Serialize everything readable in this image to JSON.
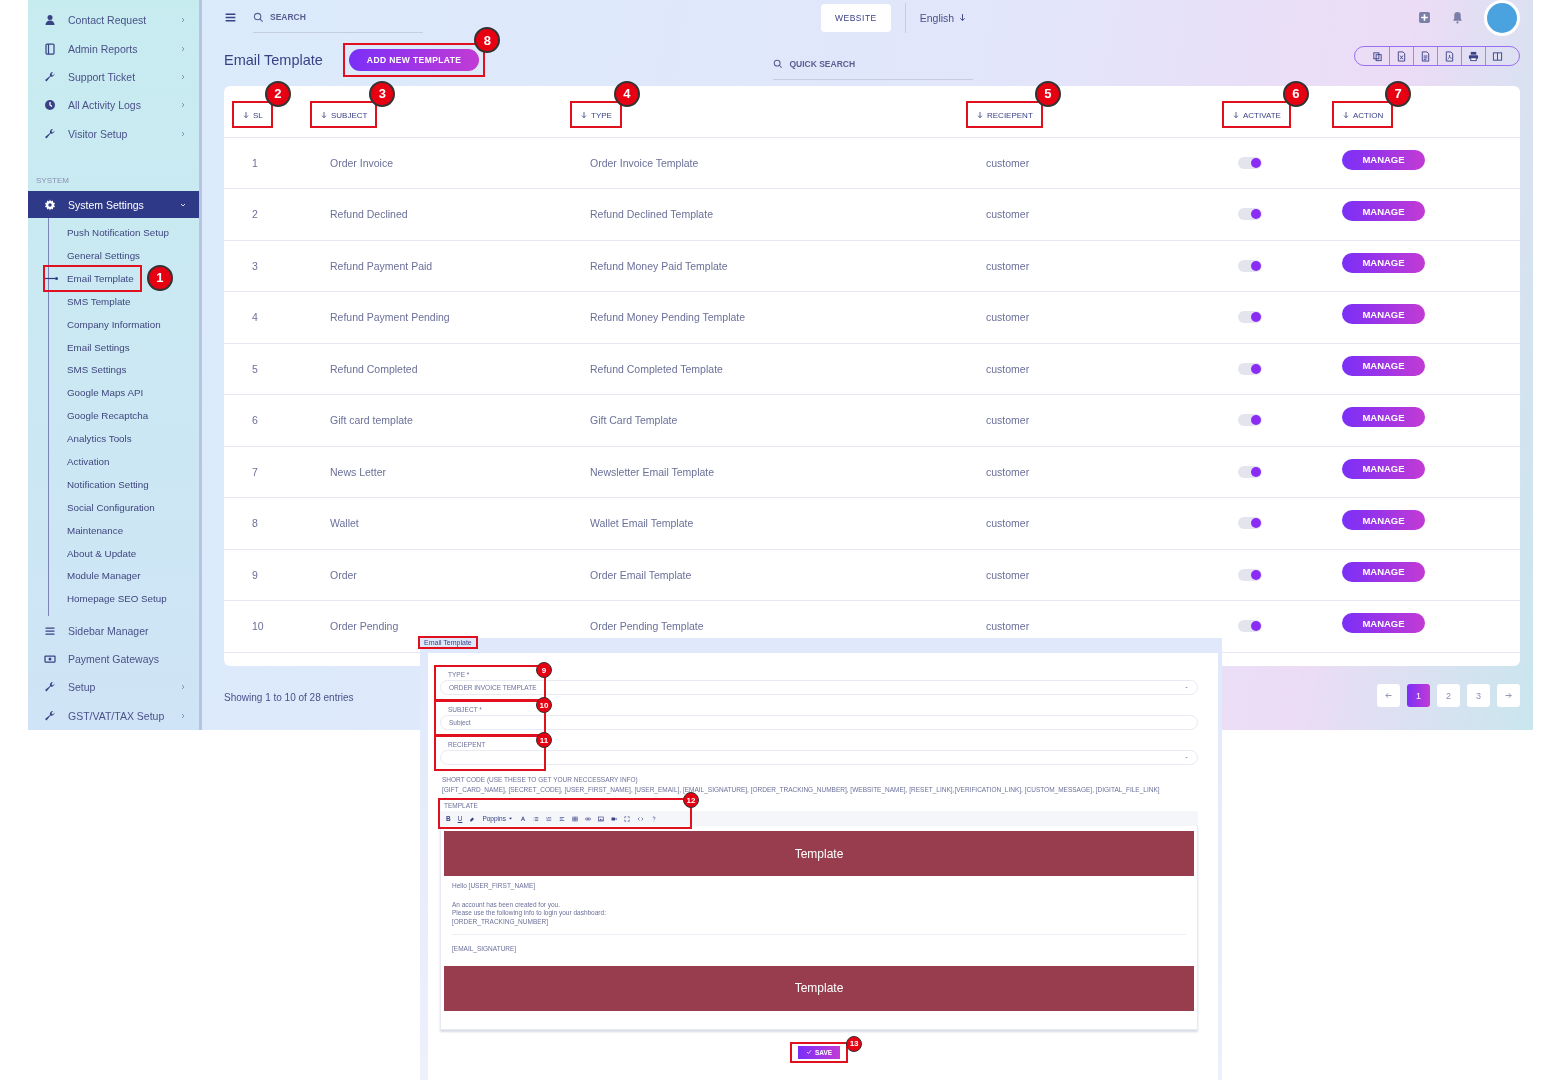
{
  "sidebar": {
    "top_items": [
      {
        "label": "Contact Request",
        "has_submenu": true
      },
      {
        "label": "Admin Reports",
        "has_submenu": true
      },
      {
        "label": "Support Ticket",
        "has_submenu": true
      },
      {
        "label": "All Activity Logs",
        "has_submenu": true
      },
      {
        "label": "Visitor Setup",
        "has_submenu": true
      }
    ],
    "section": "SYSTEM",
    "settings": {
      "label": "System Settings",
      "expanded": true,
      "children": [
        {
          "label": "Push Notification Setup",
          "selected": false
        },
        {
          "label": "General Settings",
          "selected": false
        },
        {
          "label": "Email Template",
          "selected": true,
          "callout": "1"
        },
        {
          "label": "SMS Template",
          "selected": false
        },
        {
          "label": "Company Information",
          "selected": false
        },
        {
          "label": "Email Settings",
          "selected": false
        },
        {
          "label": "SMS Settings",
          "selected": false
        },
        {
          "label": "Google Maps API",
          "selected": false
        },
        {
          "label": "Google Recaptcha",
          "selected": false
        },
        {
          "label": "Analytics Tools",
          "selected": false
        },
        {
          "label": "Activation",
          "selected": false
        },
        {
          "label": "Notification Setting",
          "selected": false
        },
        {
          "label": "Social Configuration",
          "selected": false
        },
        {
          "label": "Maintenance",
          "selected": false
        },
        {
          "label": "About & Update",
          "selected": false
        },
        {
          "label": "Module Manager",
          "selected": false
        },
        {
          "label": "Homepage SEO Setup",
          "selected": false
        }
      ]
    },
    "bottom_items": [
      {
        "label": "Sidebar Manager",
        "has_submenu": false
      },
      {
        "label": "Payment Gateways",
        "has_submenu": false
      },
      {
        "label": "Setup",
        "has_submenu": true
      },
      {
        "label": "GST/VAT/TAX Setup",
        "has_submenu": true
      }
    ]
  },
  "topbar": {
    "search_placeholder": "SEARCH",
    "website": "WEBSITE",
    "language": "English"
  },
  "page": {
    "title": "Email Template",
    "add_button": {
      "label": "ADD NEW TEMPLATE",
      "callout": "8"
    },
    "quick_search_placeholder": "QUICK SEARCH"
  },
  "table": {
    "columns": [
      {
        "label": "SL",
        "callout": "2"
      },
      {
        "label": "SUBJECT",
        "callout": "3"
      },
      {
        "label": "TYPE",
        "callout": "4"
      },
      {
        "label": "RECIEPENT",
        "callout": "5"
      },
      {
        "label": "ACTIVATE",
        "callout": "6"
      },
      {
        "label": "ACTION",
        "callout": "7"
      }
    ],
    "rows": [
      {
        "sl": "1",
        "subject": "Order Invoice",
        "type": "Order Invoice Template",
        "recipient": "customer",
        "on": true,
        "action": "MANAGE"
      },
      {
        "sl": "2",
        "subject": "Refund Declined",
        "type": "Refund Declined Template",
        "recipient": "customer",
        "on": true,
        "action": "MANAGE"
      },
      {
        "sl": "3",
        "subject": "Refund Payment Paid",
        "type": "Refund Money Paid Template",
        "recipient": "customer",
        "on": true,
        "action": "MANAGE"
      },
      {
        "sl": "4",
        "subject": "Refund Payment Pending",
        "type": "Refund Money Pending Template",
        "recipient": "customer",
        "on": true,
        "action": "MANAGE"
      },
      {
        "sl": "5",
        "subject": "Refund Completed",
        "type": "Refund Completed Template",
        "recipient": "customer",
        "on": true,
        "action": "MANAGE"
      },
      {
        "sl": "6",
        "subject": "Gift card template",
        "type": "Gift Card Template",
        "recipient": "customer",
        "on": true,
        "action": "MANAGE"
      },
      {
        "sl": "7",
        "subject": "News Letter",
        "type": "Newsletter Email Template",
        "recipient": "customer",
        "on": true,
        "action": "MANAGE"
      },
      {
        "sl": "8",
        "subject": "Wallet",
        "type": "Wallet Email Template",
        "recipient": "customer",
        "on": true,
        "action": "MANAGE"
      },
      {
        "sl": "9",
        "subject": "Order",
        "type": "Order Email Template",
        "recipient": "customer",
        "on": true,
        "action": "MANAGE"
      },
      {
        "sl": "10",
        "subject": "Order Pending",
        "type": "Order Pending Template",
        "recipient": "customer",
        "on": true,
        "action": "MANAGE"
      }
    ]
  },
  "footer": {
    "showing": "Showing 1 to 10 of 28 entries",
    "pages": [
      {
        "label": "1",
        "selected": true
      },
      {
        "label": "2",
        "selected": false
      },
      {
        "label": "3",
        "selected": false
      }
    ]
  },
  "inset": {
    "header": "Email Template",
    "fields": [
      {
        "kind": "select",
        "label": "TYPE *",
        "value": "ORDER INVOICE TEMPLATE",
        "callout": "9"
      },
      {
        "kind": "text",
        "label": "SUBJECT *",
        "placeholder": "Subject",
        "callout": "10"
      },
      {
        "kind": "select",
        "label": "RECIEPENT",
        "callout": "11"
      }
    ],
    "short_code_label": "SHORT CODE (USE THESE TO GET YOUR NECCESSARY INFO)",
    "short_codes": "[GIFT_CARD_NAME], [SECRET_CODE], [USER_FIRST_NAME], [USER_EMAIL], [EMAIL_SIGNATURE], [ORDER_TRACKING_NUMBER], [WEBSITE_NAME], [RESET_LINK],[VERIFICATION_LINK], [CUSTOM_MESSAGE], [DIGITAL_FILE_LINK]",
    "template_label": "TEMPLATE",
    "template_callout": "12",
    "toolbar": {
      "bold": "B",
      "underline": "U",
      "font_name": "Poppins"
    },
    "editor": {
      "banner_top": "Template",
      "greeting": "Hello [USER_FIRST_NAME]",
      "lines": [
        "An account has been created for you.",
        "Please use the following info to login your dashboard:",
        "[ORDER_TRACKING_NUMBER]"
      ],
      "signature": "[EMAIL_SIGNATURE]",
      "banner_bottom": "Template"
    },
    "save": {
      "label": "SAVE",
      "callout": "13"
    }
  }
}
